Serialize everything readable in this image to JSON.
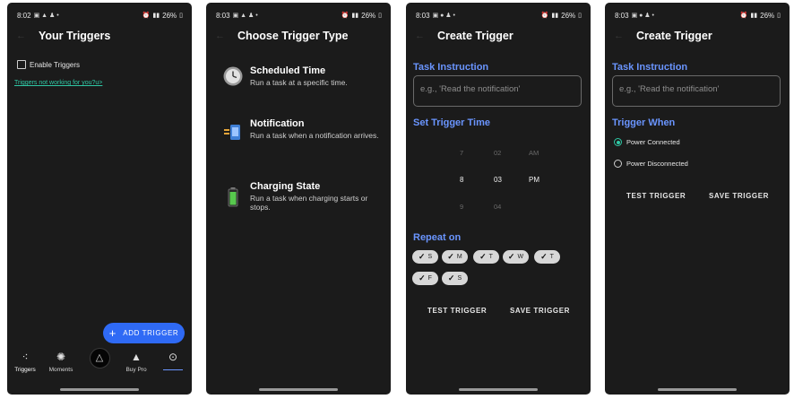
{
  "colors": {
    "background": "#1b1b1b",
    "accent_blue": "#6a95ff",
    "fab": "#2f6af5",
    "link_teal": "#2fc8a5"
  },
  "screens": [
    {
      "status": {
        "time": "8:02",
        "battery": "26%"
      },
      "title": "Your Triggers",
      "enable_label": "Enable Triggers",
      "help_link": "Triggers not working for you?u>",
      "fab_label": "ADD TRIGGER",
      "nav": [
        {
          "label": "Triggers",
          "icon": "triggers-icon"
        },
        {
          "label": "Moments",
          "icon": "moments-icon"
        },
        {
          "label": "",
          "icon": "delta-icon"
        },
        {
          "label": "Buy Pro",
          "icon": "pro-icon"
        },
        {
          "label": "",
          "icon": "more-icon"
        }
      ]
    },
    {
      "status": {
        "time": "8:03",
        "battery": "26%"
      },
      "title": "Choose Trigger Type",
      "types": [
        {
          "name": "Scheduled Time",
          "desc": "Run a task at a specific time.",
          "icon": "clock-icon"
        },
        {
          "name": "Notification",
          "desc": "Run a task when a notification arrives.",
          "icon": "notification-icon"
        },
        {
          "name": "Charging State",
          "desc": "Run a task when charging starts or stops.",
          "icon": "battery-icon"
        }
      ]
    },
    {
      "status": {
        "time": "8:03",
        "battery": "26%"
      },
      "title": "Create Trigger",
      "task_instruction_label": "Task Instruction",
      "task_placeholder": "e.g., 'Read the notification'",
      "set_time_label": "Set Trigger Time",
      "picker": {
        "hours": [
          "7",
          "8",
          "9"
        ],
        "minutes": [
          "02",
          "03",
          "04"
        ],
        "ampm": [
          "AM",
          "PM"
        ],
        "selected": {
          "hour": "8",
          "minute": "03",
          "ampm": "PM"
        }
      },
      "repeat_label": "Repeat on",
      "days": [
        "S",
        "M",
        "T",
        "W",
        "T",
        "F",
        "S"
      ],
      "test_label": "TEST TRIGGER",
      "save_label": "SAVE TRIGGER"
    },
    {
      "status": {
        "time": "8:03",
        "battery": "26%"
      },
      "title": "Create Trigger",
      "task_instruction_label": "Task Instruction",
      "task_placeholder": "e.g., 'Read the notification'",
      "trigger_when_label": "Trigger When",
      "options": [
        {
          "label": "Power Connected",
          "selected": true
        },
        {
          "label": "Power Disconnected",
          "selected": false
        }
      ],
      "test_label": "TEST TRIGGER",
      "save_label": "SAVE TRIGGER"
    }
  ]
}
